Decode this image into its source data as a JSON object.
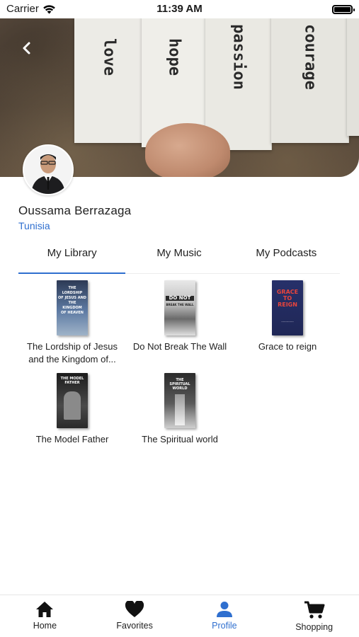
{
  "status_bar": {
    "carrier": "Carrier",
    "time": "11:39 AM"
  },
  "banner": {
    "words": [
      "love",
      "hope",
      "passion",
      "courage"
    ]
  },
  "profile": {
    "name": "Oussama Berrazaga",
    "country": "Tunisia"
  },
  "tabs": [
    {
      "label": "My Library",
      "active": true
    },
    {
      "label": "My Music",
      "active": false
    },
    {
      "label": "My Podcasts",
      "active": false
    }
  ],
  "library": [
    {
      "title": "The Lordship of Jesus and the Kingdom of...",
      "cover_color": "#4b6a8e"
    },
    {
      "title": "Do Not Break The Wall",
      "cover_color": "#d9d9d9"
    },
    {
      "title": "Grace to reign",
      "cover_color": "#2a3569"
    },
    {
      "title": "The Model Father",
      "cover_color": "#2c2c2c"
    },
    {
      "title": "The Spiritual world",
      "cover_color": "#3a3a3a"
    }
  ],
  "bottom_nav": [
    {
      "label": "Home",
      "icon": "home-icon",
      "active": false
    },
    {
      "label": "Favorites",
      "icon": "heart-icon",
      "active": false
    },
    {
      "label": "Profile",
      "icon": "person-icon",
      "active": true
    },
    {
      "label": "Shopping",
      "icon": "cart-icon",
      "active": false
    }
  ],
  "colors": {
    "accent": "#2f6fcf",
    "text": "#1f1f1f"
  }
}
